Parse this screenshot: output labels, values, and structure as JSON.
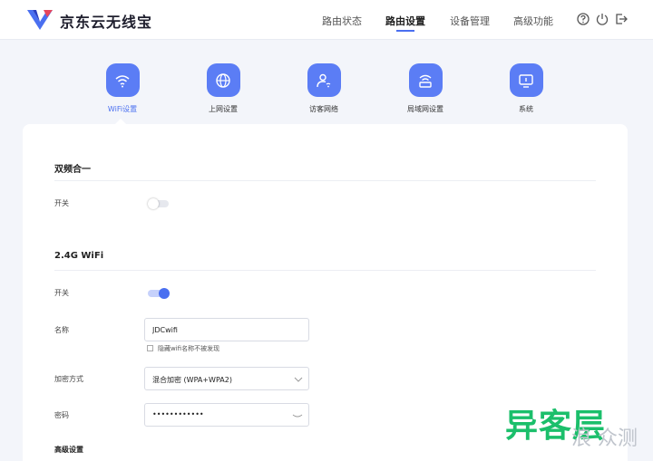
{
  "header": {
    "brand": "京东云无线宝",
    "nav": [
      {
        "label": "路由状态"
      },
      {
        "label": "路由设置"
      },
      {
        "label": "设备管理"
      },
      {
        "label": "高级功能"
      }
    ],
    "icons": [
      "help-icon",
      "power-icon",
      "logout-icon"
    ]
  },
  "categories": [
    {
      "label": "WiFi设置",
      "icon": "wifi-icon"
    },
    {
      "label": "上网设置",
      "icon": "globe-icon"
    },
    {
      "label": "访客网络",
      "icon": "guest-user-icon"
    },
    {
      "label": "局域网设置",
      "icon": "lan-icon"
    },
    {
      "label": "系统",
      "icon": "monitor-icon"
    }
  ],
  "dual_band": {
    "title": "双频合一",
    "switch_label": "开关",
    "enabled": false
  },
  "wifi24": {
    "title": "2.4G WiFi",
    "switch_label": "开关",
    "enabled": true,
    "name_label": "名称",
    "name_value": "JDCwifi",
    "hide_label": "隐藏wifi名称不被发现",
    "encrypt_label": "加密方式",
    "encrypt_value": "混合加密 (WPA+WPA2)",
    "password_label": "密码",
    "password_value": "••••••••••••"
  },
  "advanced": {
    "title": "高级设置"
  },
  "watermark": {
    "main": "异客层",
    "sub": "浪 众测"
  },
  "colors": {
    "accent": "#4a6ff0",
    "icon_bg": "#5b7df5",
    "watermark": "#1bbf6b"
  }
}
